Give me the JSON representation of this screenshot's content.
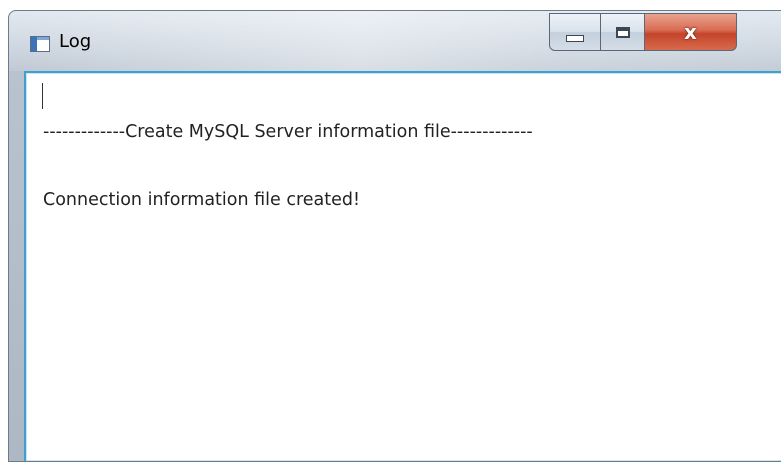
{
  "window": {
    "title": "Log",
    "icon": "application-window-icon",
    "controls": {
      "minimize": "minimize-icon",
      "maximize": "maximize-icon",
      "close": "x"
    }
  },
  "log": {
    "lines": [
      "-------------Create MySQL Server information file-------------",
      "Connection information file created!"
    ]
  },
  "colors": {
    "close_button": "#c9452b",
    "text_border_focus": "#3ea0cf"
  }
}
